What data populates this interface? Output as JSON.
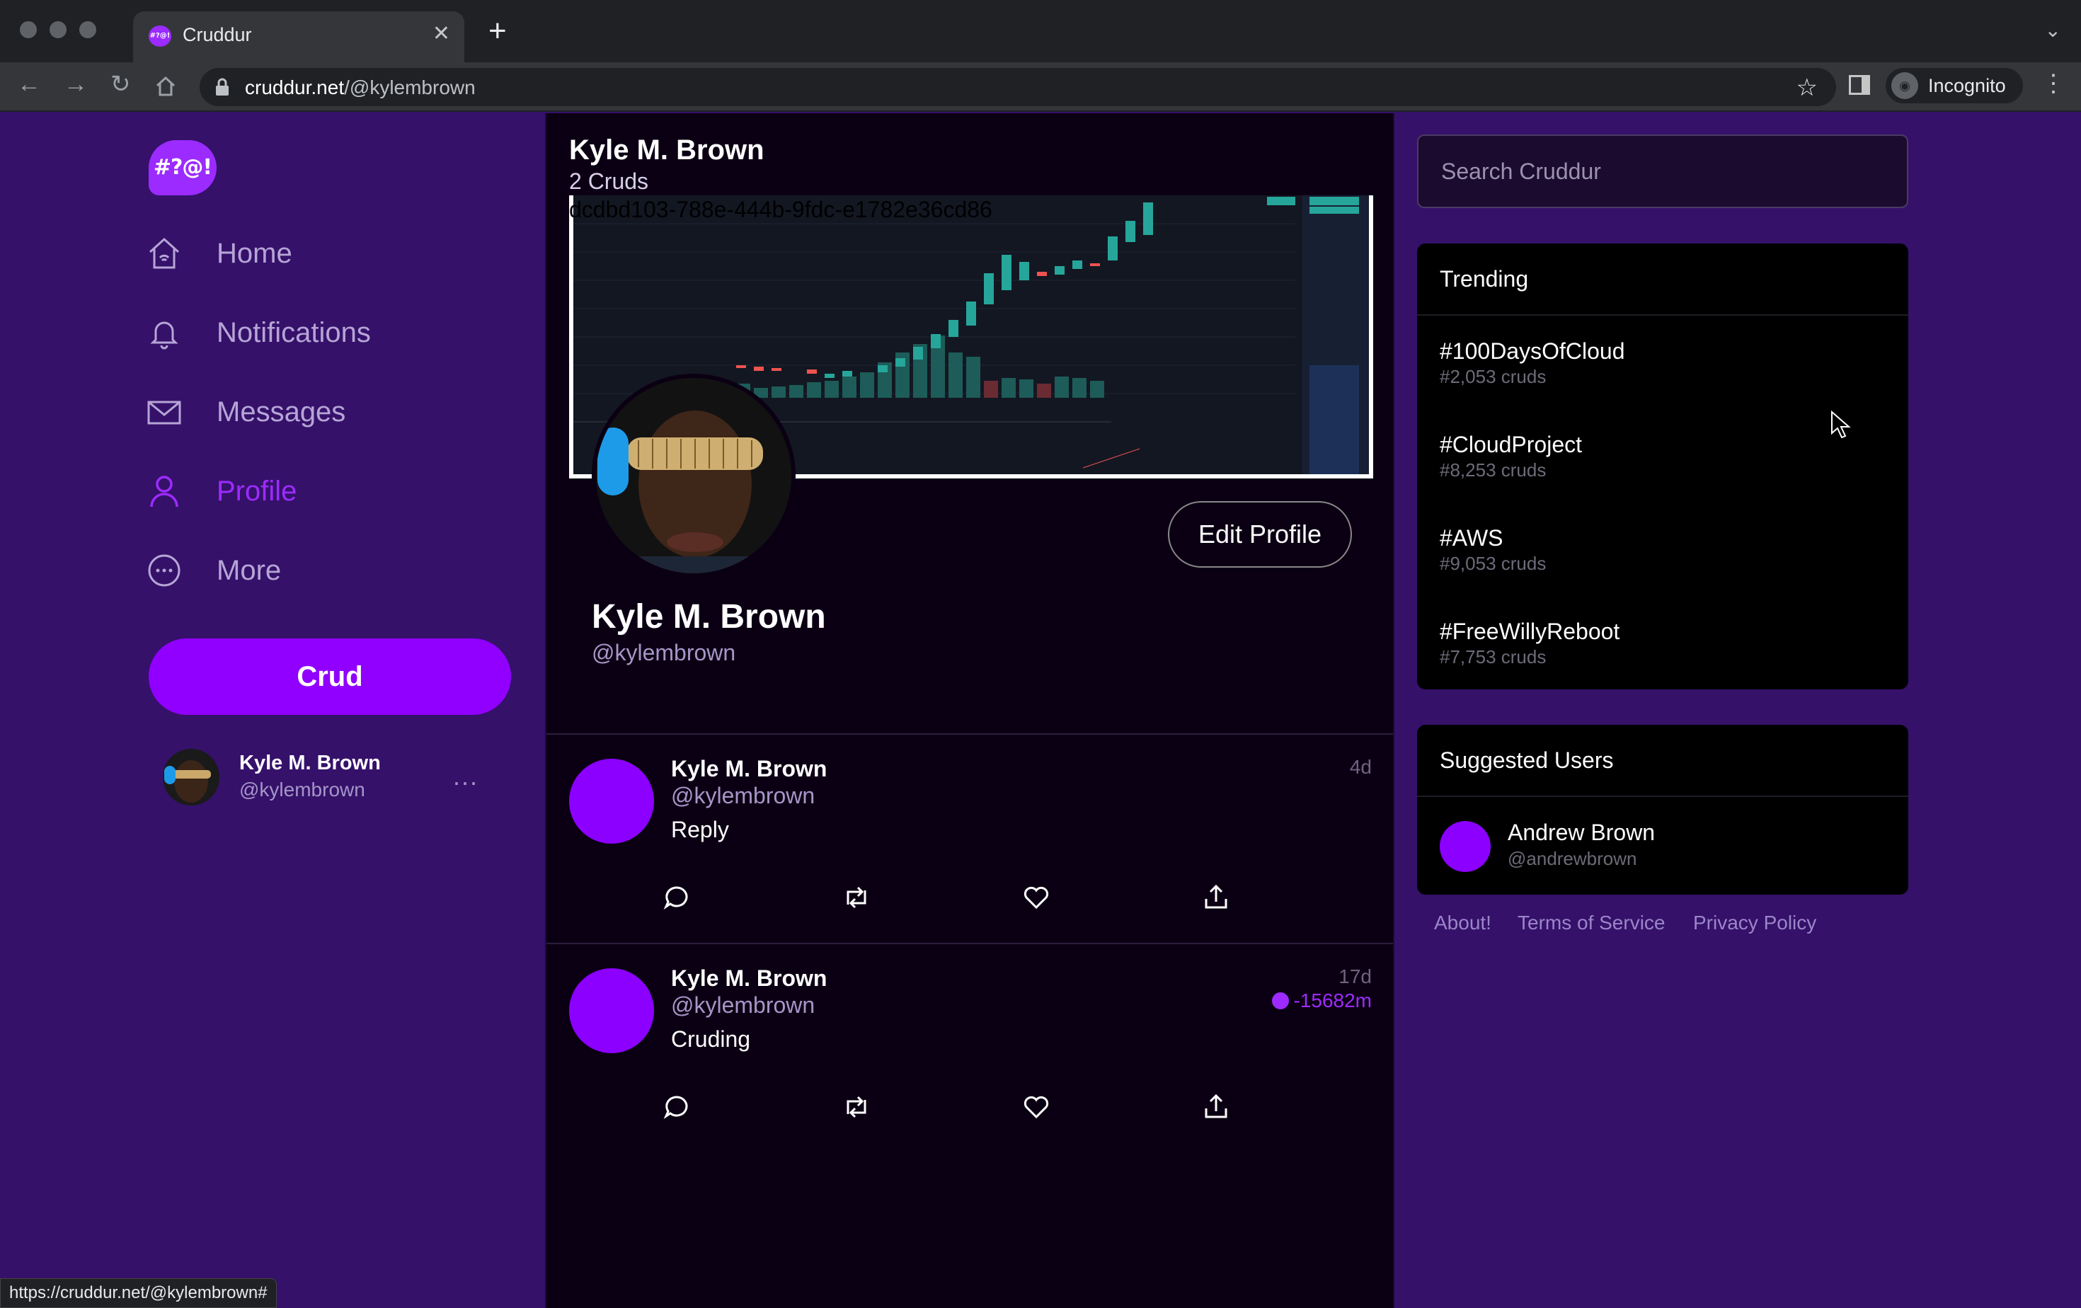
{
  "browser": {
    "tab_title": "Cruddur",
    "favicon_text": "#?@!",
    "url_host": "cruddur.net",
    "url_path": "/@kylembrown",
    "profile_label": "Incognito",
    "status_url": "https://cruddur.net/@kylembrown#"
  },
  "sidebar": {
    "logo_text": "#?@!",
    "items": [
      {
        "label": "Home",
        "icon": "home-icon"
      },
      {
        "label": "Notifications",
        "icon": "bell-icon"
      },
      {
        "label": "Messages",
        "icon": "envelope-icon"
      },
      {
        "label": "Profile",
        "icon": "user-icon",
        "active": true
      },
      {
        "label": "More",
        "icon": "ellipsis-circle-icon"
      }
    ],
    "crud_button": "Crud",
    "account": {
      "name": "Kyle M. Brown",
      "handle": "@kylembrown",
      "more": "..."
    }
  },
  "profile": {
    "header_name": "Kyle M. Brown",
    "crud_count": "2 Cruds",
    "banner_id": "dcdbd103-788e-444b-9fdc-e1782e36cd86",
    "display_name": "Kyle M. Brown",
    "handle": "@kylembrown",
    "edit_button": "Edit Profile"
  },
  "posts": [
    {
      "name": "Kyle M. Brown",
      "handle": "@kylembrown",
      "text": "Reply",
      "time": "4d",
      "location": ""
    },
    {
      "name": "Kyle M. Brown",
      "handle": "@kylembrown",
      "text": "Cruding",
      "time": "17d",
      "location": "-15682m"
    }
  ],
  "search": {
    "placeholder": "Search Cruddur"
  },
  "trending": {
    "title": "Trending",
    "items": [
      {
        "tag": "#100DaysOfCloud",
        "count": "#2,053 cruds"
      },
      {
        "tag": "#CloudProject",
        "count": "#8,253 cruds"
      },
      {
        "tag": "#AWS",
        "count": "#9,053 cruds"
      },
      {
        "tag": "#FreeWillyReboot",
        "count": "#7,753 cruds"
      }
    ]
  },
  "suggested": {
    "title": "Suggested Users",
    "users": [
      {
        "name": "Andrew Brown",
        "handle": "@andrewbrown"
      }
    ]
  },
  "footer": {
    "links": [
      "About!",
      "Terms of Service",
      "Privacy Policy"
    ]
  },
  "colors": {
    "brand": "#9100ff",
    "background": "#35116a",
    "feed": "#0b0013",
    "panel": "#000000"
  }
}
